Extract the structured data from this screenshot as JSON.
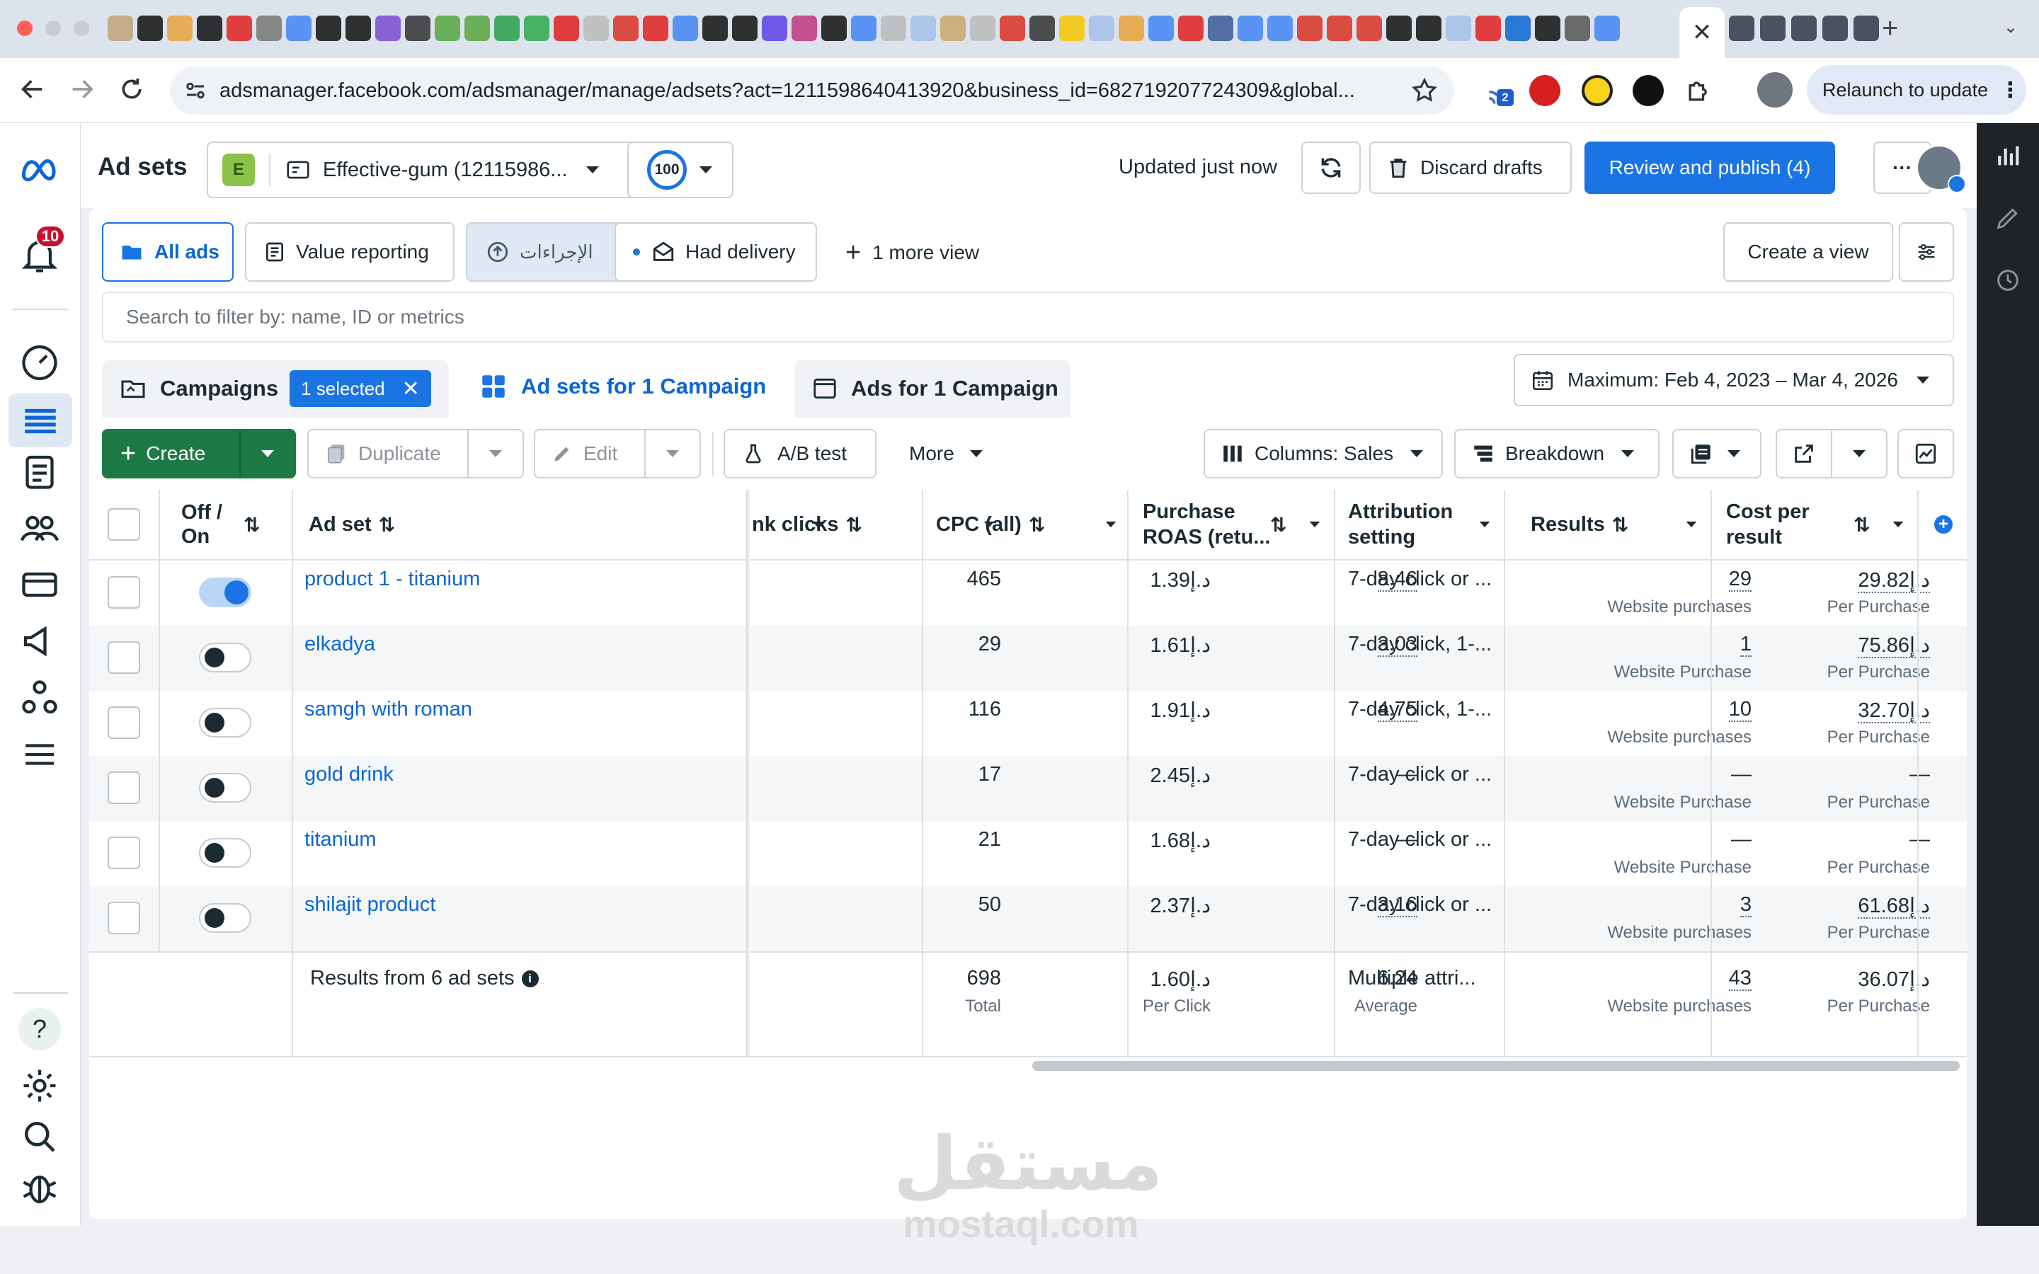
{
  "browser": {
    "url": "adsmanager.facebook.com/adsmanager/manage/adsets?act=1211598640413920&business_id=682719207724309&global...",
    "relaunch_label": "Relaunch to update",
    "extension_badge": "2"
  },
  "leftnav": {
    "notification_count": "10"
  },
  "header": {
    "title": "Ad sets",
    "account_initial": "E",
    "account_name": "Effective-gum (12115986...",
    "score": "100",
    "updated_text": "Updated just now",
    "discard_label": "Discard drafts",
    "publish_label": "Review and publish (4)",
    "more_label": "···"
  },
  "views": {
    "all_ads": "All ads",
    "value_reporting": "Value reporting",
    "actions_arabic": "الإجراءات",
    "had_delivery": "Had delivery",
    "more_view": "1 more view",
    "create_view": "Create a view"
  },
  "search": {
    "placeholder": "Search to filter by: name, ID or metrics"
  },
  "level_tabs": {
    "campaigns": "Campaigns",
    "selected_chip": "1 selected",
    "adsets": "Ad sets for 1 Campaign",
    "ads": "Ads for 1 Campaign"
  },
  "date_range": "Maximum: Feb 4, 2023 – Mar 4, 2026",
  "toolbar": {
    "create": "Create",
    "duplicate": "Duplicate",
    "edit": "Edit",
    "ab_test": "A/B test",
    "more": "More",
    "columns": "Columns: Sales",
    "breakdown": "Breakdown"
  },
  "table": {
    "headers": {
      "off_on": [
        "Off /",
        "On"
      ],
      "ad_set": "Ad set",
      "link_clicks": "nk clicks",
      "cpc": "CPC (all)",
      "roas": [
        "Purchase",
        "ROAS (retu..."
      ],
      "attribution": [
        "Attribution",
        "setting"
      ],
      "results": "Results",
      "cost": [
        "Cost per",
        "result"
      ]
    },
    "rows": [
      {
        "name": "product 1 - titanium",
        "on": true,
        "clicks": "465",
        "cpc": "د.إ1.39",
        "roas": "8.46",
        "attr": "7-day click or ...",
        "results": "29",
        "results_label": "Website purchases",
        "cost": "د.إ29.82",
        "cost_label": "Per Purchase"
      },
      {
        "name": "elkadya",
        "on": false,
        "clicks": "29",
        "cpc": "د.إ1.61",
        "roas": "3.03",
        "attr": "7-day click, 1-...",
        "results": "1",
        "results_label": "Website Purchase",
        "cost": "د.إ75.86",
        "cost_label": "Per Purchase"
      },
      {
        "name": "samgh with roman",
        "on": false,
        "clicks": "116",
        "cpc": "د.إ1.91",
        "roas": "4.75",
        "attr": "7-day click, 1-...",
        "results": "10",
        "results_label": "Website purchases",
        "cost": "د.إ32.70",
        "cost_label": "Per Purchase"
      },
      {
        "name": "gold drink",
        "on": false,
        "clicks": "17",
        "cpc": "د.إ2.45",
        "roas": "—",
        "attr": "7-day click or ...",
        "results": "—",
        "results_label": "Website Purchase",
        "cost": "—",
        "cost_label": "Per Purchase"
      },
      {
        "name": "titanium",
        "on": false,
        "clicks": "21",
        "cpc": "د.إ1.68",
        "roas": "—",
        "attr": "7-day click or ...",
        "results": "—",
        "results_label": "Website Purchase",
        "cost": "—",
        "cost_label": "Per Purchase"
      },
      {
        "name": "shilajit product",
        "on": false,
        "clicks": "50",
        "cpc": "د.إ2.37",
        "roas": "3.16",
        "attr": "7-day click or ...",
        "results": "3",
        "results_label": "Website purchases",
        "cost": "د.إ61.68",
        "cost_label": "Per Purchase"
      }
    ],
    "totals": {
      "label": "Results from 6 ad sets",
      "clicks": "698",
      "clicks_label": "Total",
      "cpc": "د.إ1.60",
      "cpc_label": "Per Click",
      "roas": "6.24",
      "roas_label": "Average",
      "attr": "Multiple attri...",
      "results": "43",
      "results_label": "Website purchases",
      "cost": "د.إ36.07",
      "cost_label": "Per Purchase"
    }
  },
  "watermark": {
    "arabic": "مستقل",
    "latin": "mostaql.com"
  },
  "colors": {
    "accent": "#1b74e4",
    "link": "#0a66d6",
    "create_green": "#1e7a45",
    "rail": "#1f2327"
  }
}
